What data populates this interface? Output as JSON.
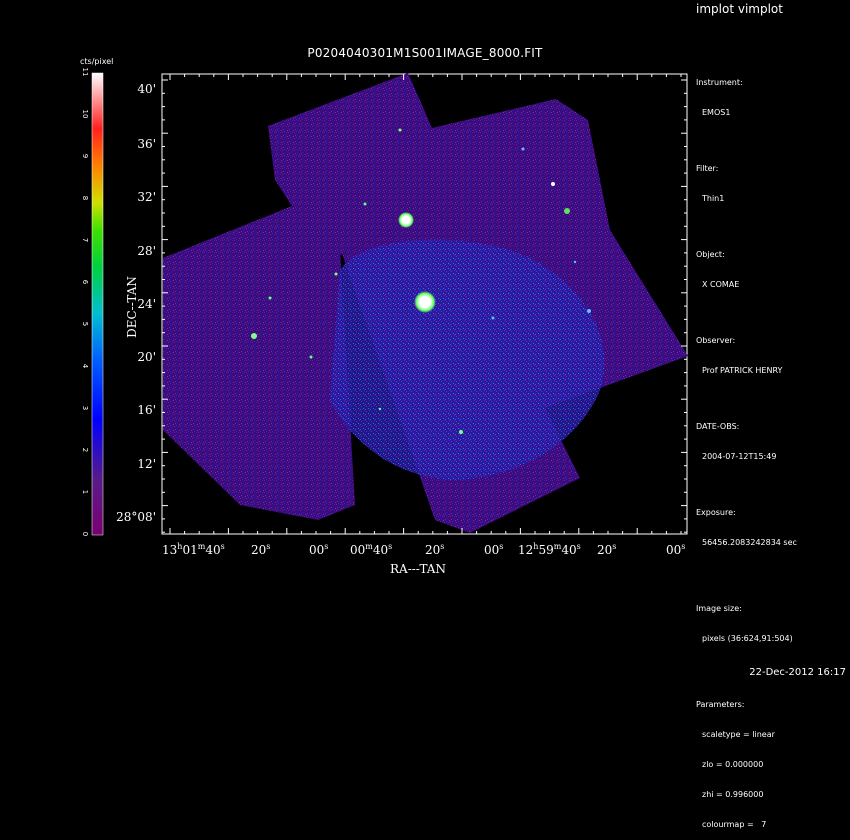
{
  "app": {
    "title": "implot vimplot"
  },
  "image": {
    "title": "P0204040301M1S001IMAGE_8000.FIT"
  },
  "colorbar": {
    "label": "cts/pixel",
    "ticks": [
      "0",
      "1",
      "2",
      "3",
      "4",
      "5",
      "6",
      "7",
      "8",
      "9",
      "10",
      "11"
    ]
  },
  "axes": {
    "ylabel": "DEC--TAN",
    "xlabel": "RA---TAN",
    "yticks": [
      "40'",
      "36'",
      "32'",
      "28'",
      "24'",
      "20'",
      "16'",
      "12'",
      "28°08'"
    ],
    "xticks": [
      {
        "main": "13",
        "sup1": "h",
        "mid": "01",
        "sup2": "m",
        "tail": "40",
        "sup3": "s"
      },
      {
        "main": "20",
        "sup1": "s"
      },
      {
        "main": "00",
        "sup1": "s"
      },
      {
        "main": "00",
        "sup1": "m",
        "tail": "40",
        "sup3": "s"
      },
      {
        "main": "20",
        "sup1": "s"
      },
      {
        "main": "00",
        "sup1": "s"
      },
      {
        "main": "12",
        "sup1": "h",
        "mid": "59",
        "sup2": "m",
        "tail": "40",
        "sup3": "s"
      },
      {
        "main": "20",
        "sup1": "s"
      },
      {
        "main": "00",
        "sup1": "s"
      }
    ]
  },
  "info": {
    "instrument_label": "Instrument:",
    "instrument": "EMOS1",
    "filter_label": "Filter:",
    "filter": "Thin1",
    "object_label": "Object:",
    "object": "X COMAE",
    "observer_label": "Observer:",
    "observer": "Prof PATRICK HENRY",
    "date_label": "DATE-OBS:",
    "date": "2004-07-12T15:49",
    "exposure_label": "Exposure:",
    "exposure": "56456.2083242834 sec",
    "size_label": "Image size:",
    "size": "pixels (36:624,91:504)",
    "params_label": "Parameters:",
    "scaletype": "scaletype = linear",
    "zlo": "zlo = 0.000000",
    "zhi": "zhi = 0.996000",
    "colourmap": "colourmap =   7"
  },
  "footer": {
    "timestamp": "22-Dec-2012 16:17"
  },
  "colors": {
    "background": "#000000",
    "field": "#3a0a8a",
    "frame": "#ffffff"
  }
}
